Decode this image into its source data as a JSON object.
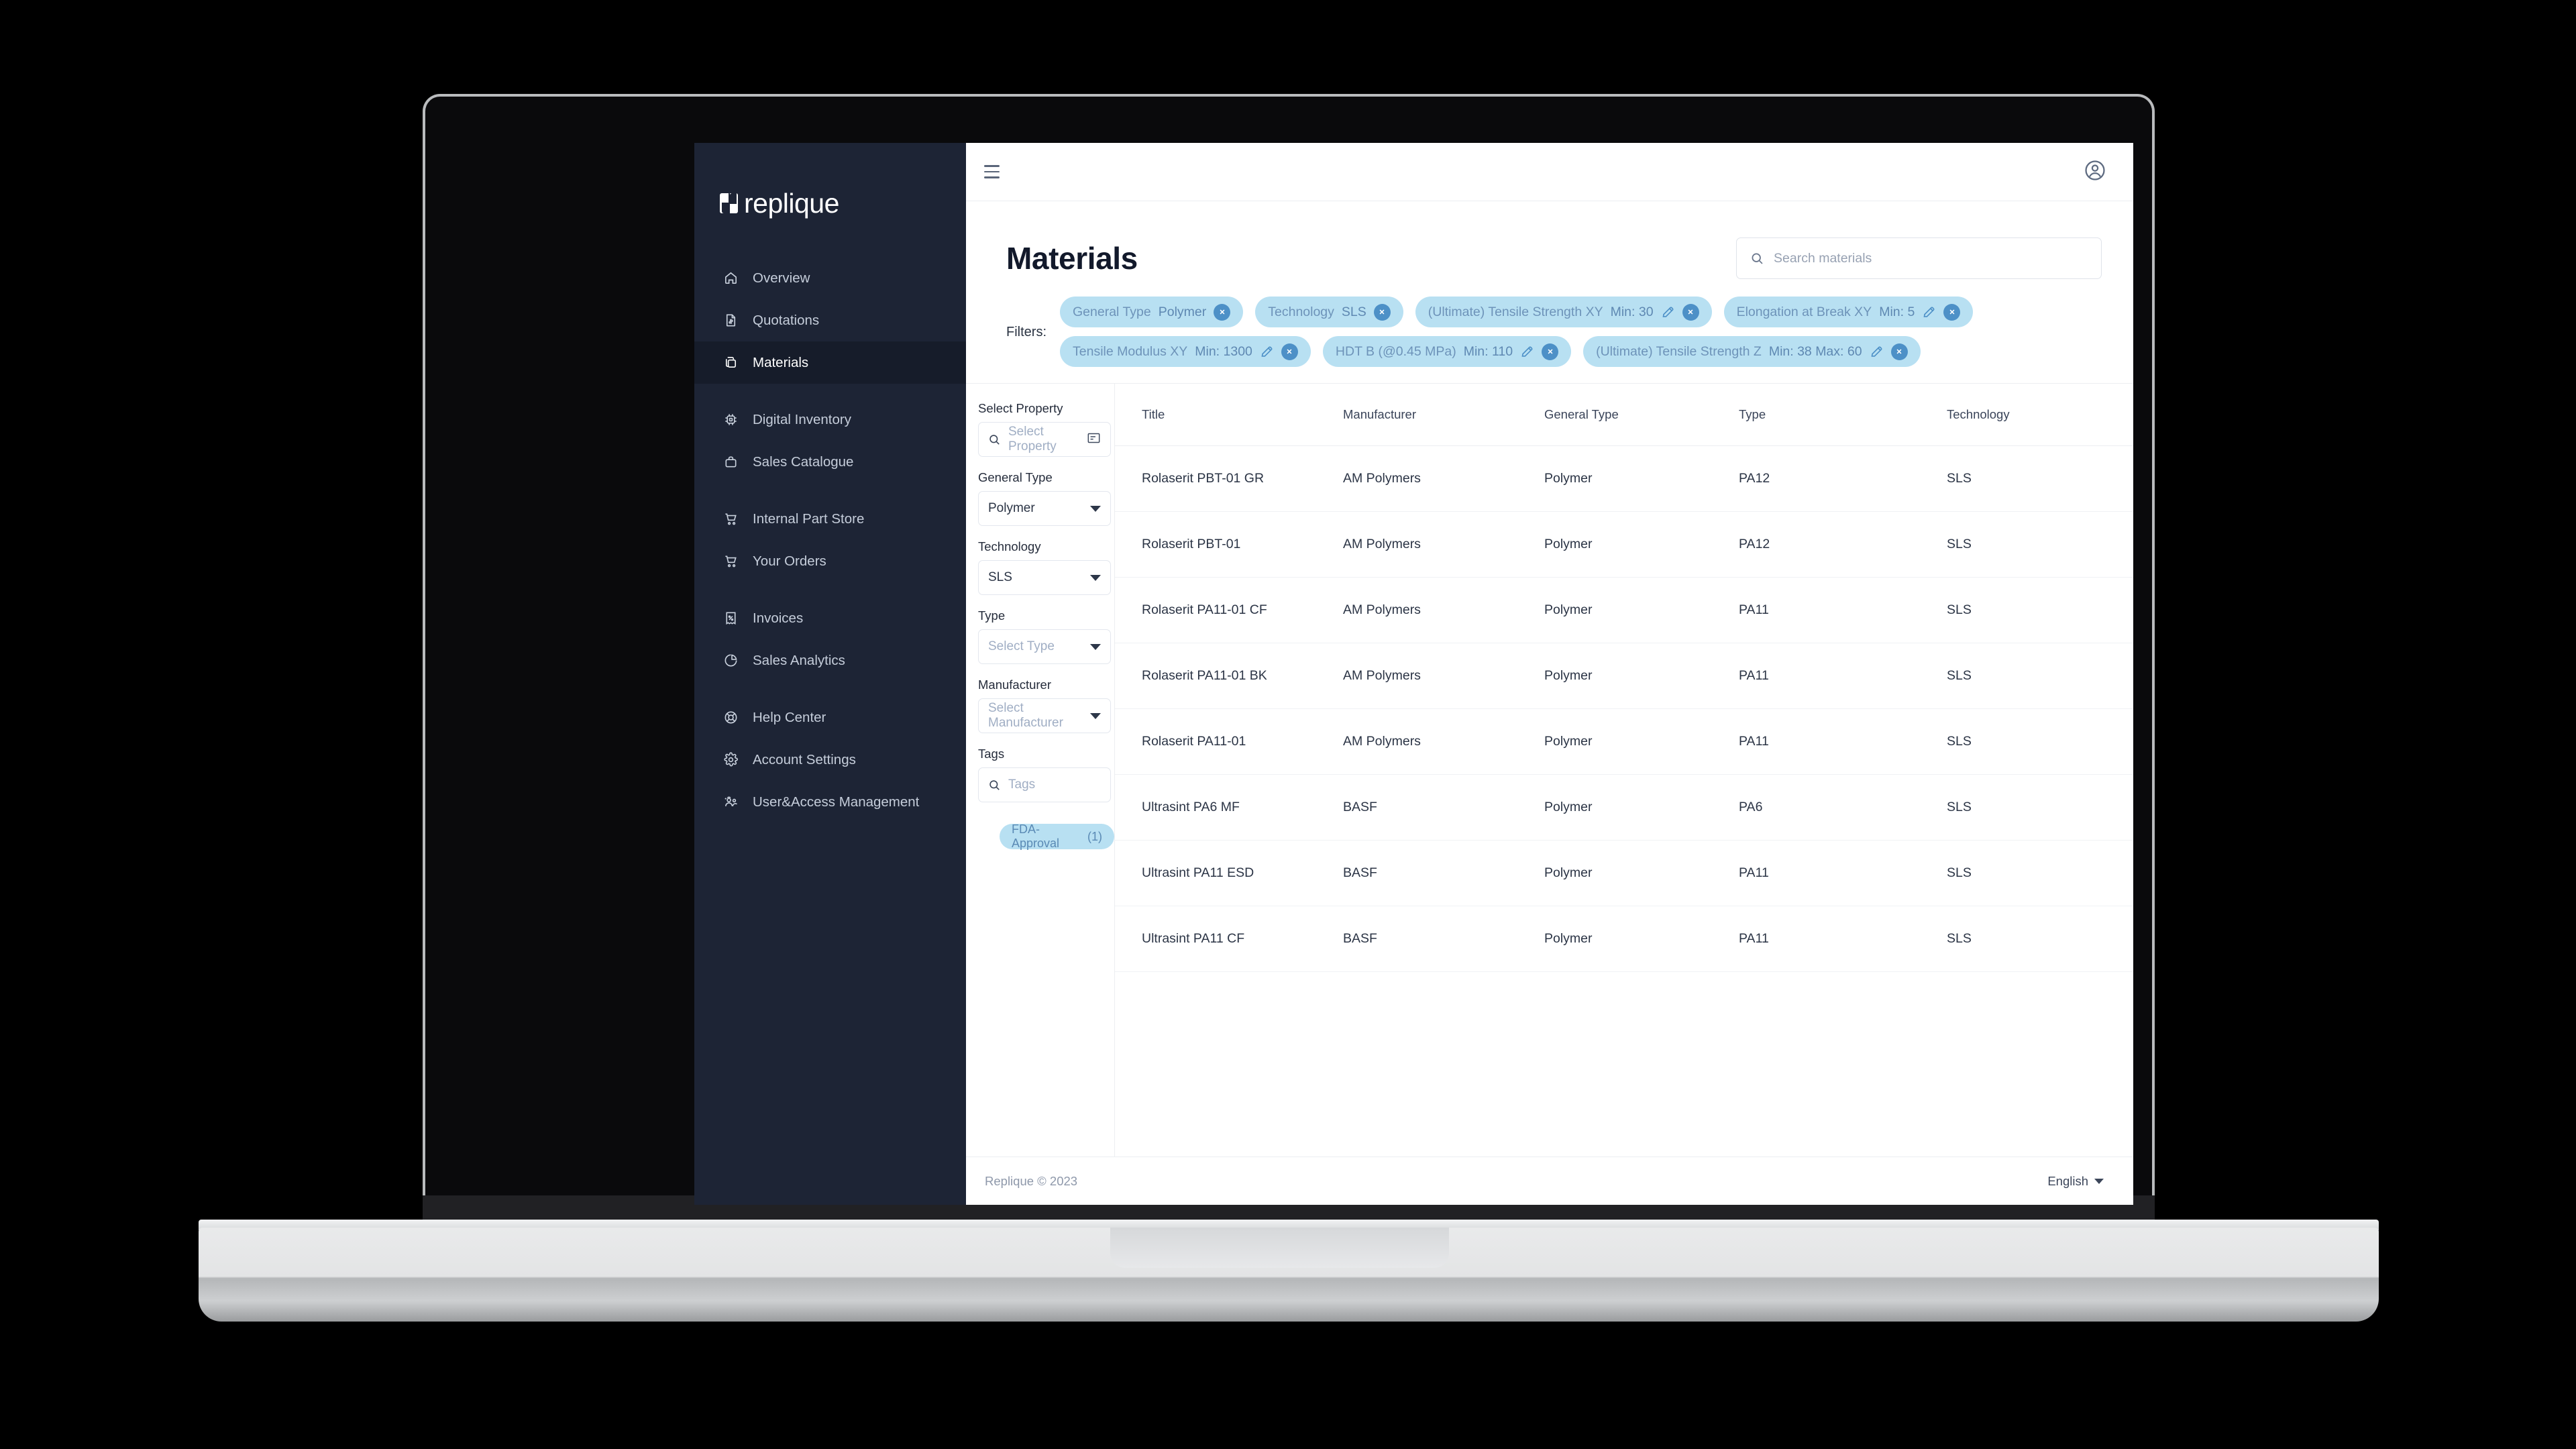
{
  "brand": {
    "name": "replique"
  },
  "sidebar": {
    "items": [
      {
        "label": "Overview",
        "icon": "home-icon",
        "active": false
      },
      {
        "label": "Quotations",
        "icon": "document-dollar-icon",
        "active": false
      },
      {
        "label": "Materials",
        "icon": "copy-layers-icon",
        "active": true
      },
      {
        "label": "Digital Inventory",
        "icon": "chip-icon",
        "active": false
      },
      {
        "label": "Sales Catalogue",
        "icon": "briefcase-icon",
        "active": false
      },
      {
        "label": "Internal Part Store",
        "icon": "cart-icon",
        "active": false
      },
      {
        "label": "Your Orders",
        "icon": "cart-icon",
        "active": false
      },
      {
        "label": "Invoices",
        "icon": "receipt-percent-icon",
        "active": false
      },
      {
        "label": "Sales Analytics",
        "icon": "pie-chart-icon",
        "active": false
      },
      {
        "label": "Help Center",
        "icon": "lifebuoy-icon",
        "active": false
      },
      {
        "label": "Account Settings",
        "icon": "gear-icon",
        "active": false
      },
      {
        "label": "User&Access Management",
        "icon": "users-icon",
        "active": false
      }
    ]
  },
  "topbar": {
    "menu_icon": "hamburger-icon",
    "profile_icon": "user-circle-icon"
  },
  "page": {
    "title": "Materials"
  },
  "search": {
    "placeholder": "Search materials",
    "value": ""
  },
  "filters": {
    "label": "Filters:",
    "chips": [
      {
        "name": "General Type",
        "value": "Polymer",
        "editable": false
      },
      {
        "name": "Technology",
        "value": "SLS",
        "editable": false
      },
      {
        "name": "(Ultimate) Tensile Strength XY",
        "value": "Min: 30",
        "editable": true
      },
      {
        "name": "Elongation at Break XY",
        "value": "Min: 5",
        "editable": true
      },
      {
        "name": "Tensile Modulus XY",
        "value": "Min: 1300",
        "editable": true
      },
      {
        "name": "HDT B (@0.45 MPa)",
        "value": "Min: 110",
        "editable": true
      },
      {
        "name": "(Ultimate) Tensile Strength Z",
        "value": "Min: 38 Max: 60",
        "editable": true
      }
    ]
  },
  "filter_panel": {
    "fields": [
      {
        "label": "Select Property",
        "value": "Select Property",
        "is_placeholder": true,
        "control": "search-with-list",
        "lead_icon": "search-icon",
        "trail_icon": "list-icon"
      },
      {
        "label": "General Type",
        "value": "Polymer",
        "is_placeholder": false,
        "control": "select",
        "trail_icon": "caret-down-icon"
      },
      {
        "label": "Technology",
        "value": "SLS",
        "is_placeholder": false,
        "control": "select",
        "trail_icon": "caret-down-icon"
      },
      {
        "label": "Type",
        "value": "Select Type",
        "is_placeholder": true,
        "control": "select",
        "trail_icon": "caret-down-icon"
      },
      {
        "label": "Manufacturer",
        "value": "Select Manufacturer",
        "is_placeholder": true,
        "control": "select",
        "trail_icon": "caret-down-icon"
      },
      {
        "label": "Tags",
        "value": "Tags",
        "is_placeholder": true,
        "control": "search",
        "lead_icon": "search-icon"
      }
    ],
    "tag_pill": {
      "label": "FDA-Approval",
      "count": "(1)"
    }
  },
  "table": {
    "columns": [
      "Title",
      "Manufacturer",
      "General Type",
      "Type",
      "Technology",
      ""
    ],
    "rows": [
      {
        "title": "Rolaserit PBT-01 GR",
        "manufacturer": "AM Polymers",
        "general_type": "Polymer",
        "type": "PA12",
        "technology": "SLS"
      },
      {
        "title": "Rolaserit PBT-01",
        "manufacturer": "AM Polymers",
        "general_type": "Polymer",
        "type": "PA12",
        "technology": "SLS"
      },
      {
        "title": "Rolaserit PA11-01 CF",
        "manufacturer": "AM Polymers",
        "general_type": "Polymer",
        "type": "PA11",
        "technology": "SLS"
      },
      {
        "title": "Rolaserit PA11-01 BK",
        "manufacturer": "AM Polymers",
        "general_type": "Polymer",
        "type": "PA11",
        "technology": "SLS"
      },
      {
        "title": "Rolaserit PA11-01",
        "manufacturer": "AM Polymers",
        "general_type": "Polymer",
        "type": "PA11",
        "technology": "SLS"
      },
      {
        "title": "Ultrasint PA6 MF",
        "manufacturer": "BASF",
        "general_type": "Polymer",
        "type": "PA6",
        "technology": "SLS"
      },
      {
        "title": "Ultrasint PA11 ESD",
        "manufacturer": "BASF",
        "general_type": "Polymer",
        "type": "PA11",
        "technology": "SLS"
      },
      {
        "title": "Ultrasint PA11 CF",
        "manufacturer": "BASF",
        "general_type": "Polymer",
        "type": "PA11",
        "technology": "SLS"
      }
    ],
    "row_menu_icon": "kebab-menu-icon",
    "row_expand_icon": "chevron-down-icon"
  },
  "footer": {
    "copyright": "Replique © 2023",
    "language": "English"
  },
  "colors": {
    "sidebar_bg": "#1d2435",
    "sidebar_active_bg": "#161c2a",
    "chip_bg": "#b8e0f2",
    "chip_text": "#5a8ab5",
    "chip_accent": "#4d90c7",
    "title_text": "#12192b"
  }
}
